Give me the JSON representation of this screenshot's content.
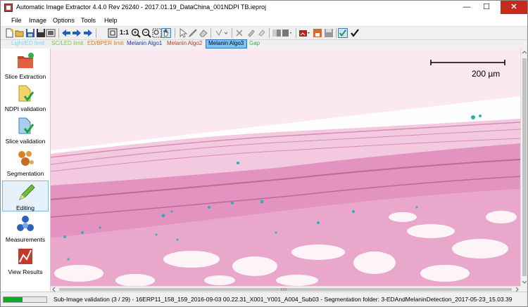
{
  "window": {
    "title": "Automatic Image Extractor 4.4.0 Rev 26240 - 2017.01.19_DataChina_001NDPI TB.ieproj",
    "minimize_glyph": "—",
    "maximize_glyph": "☐",
    "close_glyph": "✕"
  },
  "menu": [
    "File",
    "Image",
    "Options",
    "Tools",
    "Help"
  ],
  "toolbar": {
    "zoom_label": "1:1",
    "icons": [
      "new-icon",
      "open-icon",
      "save-icon",
      "save-as-icon",
      "export-icon",
      "arrow-left-icon",
      "arrow-right-icon",
      "fit-icon",
      "zoom-1-1-icon",
      "zoom-in-icon",
      "zoom-out-icon",
      "pan-icon",
      "select-icon",
      "pen-icon",
      "eraser-icon",
      "draw-tool-icon",
      "cancel-icon",
      "stamp-icon",
      "paint-icon",
      "gradient-icon",
      "color-picker-icon",
      "image-icon",
      "save-layer-icon",
      "validate-icon",
      "checkmark-icon"
    ]
  },
  "legend": [
    {
      "label": "Light/ED limit",
      "color": "#7ad7f0",
      "selected": false
    },
    {
      "label": "SC/LED limit",
      "color": "#7fc241",
      "selected": false
    },
    {
      "label": "ED/BPER limit",
      "color": "#e07b18",
      "selected": false
    },
    {
      "label": "Melanin Algo1",
      "color": "#1e2fa8",
      "selected": false
    },
    {
      "label": "Melanin Algo2",
      "color": "#c0392b",
      "selected": false
    },
    {
      "label": "Melanin Algo3",
      "color": "#7dc4f5",
      "selected": true
    },
    {
      "label": "Gap",
      "color": "#37b24d",
      "selected": false
    }
  ],
  "sidebar": [
    {
      "label": "Slice Extraction",
      "icon": "folder-extract-icon",
      "active": false
    },
    {
      "label": "NDPI validation",
      "icon": "ndpi-validation-icon",
      "active": false
    },
    {
      "label": "Slice validation",
      "icon": "slice-validation-icon",
      "active": false
    },
    {
      "label": "Segmentation",
      "icon": "segmentation-icon",
      "active": false
    },
    {
      "label": "Editing",
      "icon": "pencil-icon",
      "active": true
    },
    {
      "label": "Measurements",
      "icon": "measurements-icon",
      "active": false
    },
    {
      "label": "View Results",
      "icon": "chart-icon",
      "active": false
    }
  ],
  "image": {
    "scale_label": "200 µm"
  },
  "status": {
    "progress": 0.45,
    "text": "Sub-Image validation (3 / 29) - 16ERP11_158_159_2016-09-03 00.22.31_X001_Y001_A004_Sub03 - Segmentation folder: 3-EDAndMelaninDetection_2017-05-23_15.03.39"
  },
  "colors": {
    "background_pink": "#fbe8f1",
    "tissue_pink": "#e79ec6",
    "tissue_dark": "#c96aa1",
    "melanin_cyan": "#29b0bd",
    "selection_blue": "#7dc4f5"
  }
}
